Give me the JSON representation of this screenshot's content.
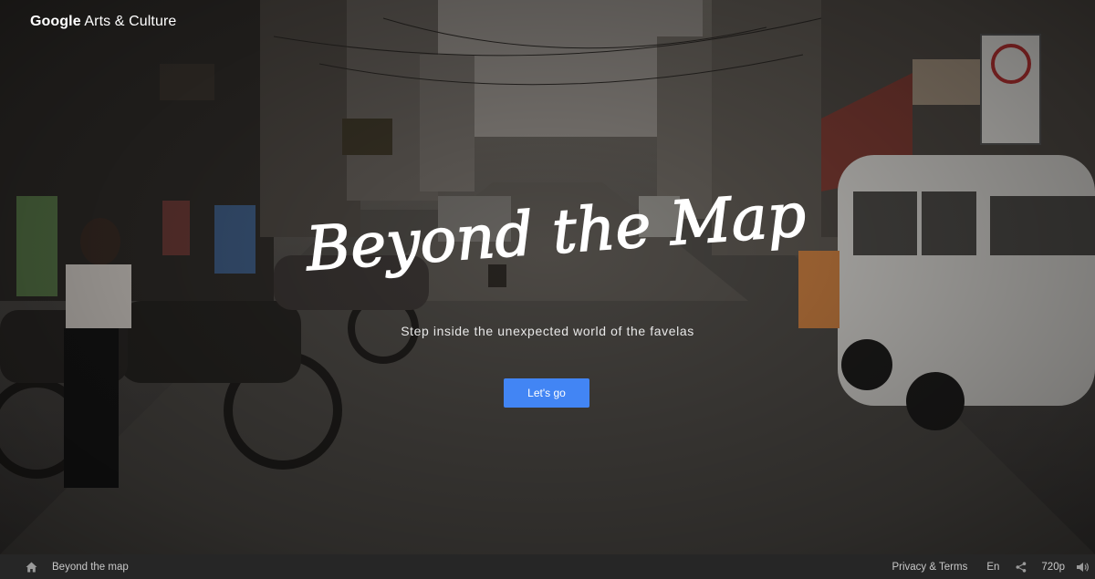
{
  "brand": {
    "google": "Google",
    "product": "Arts & Culture"
  },
  "hero": {
    "title": "Beyond the Map",
    "subtitle": "Step inside the unexpected world of the favelas",
    "cta_label": "Let's go"
  },
  "footer": {
    "home_icon": "home-icon",
    "breadcrumb": "Beyond the map",
    "privacy": "Privacy & Terms",
    "language": "En",
    "share_icon": "share-icon",
    "quality": "720p",
    "volume_icon": "volume-icon"
  },
  "colors": {
    "accent": "#4285f4",
    "footer_bg": "#262626",
    "text_light": "#ffffff"
  }
}
